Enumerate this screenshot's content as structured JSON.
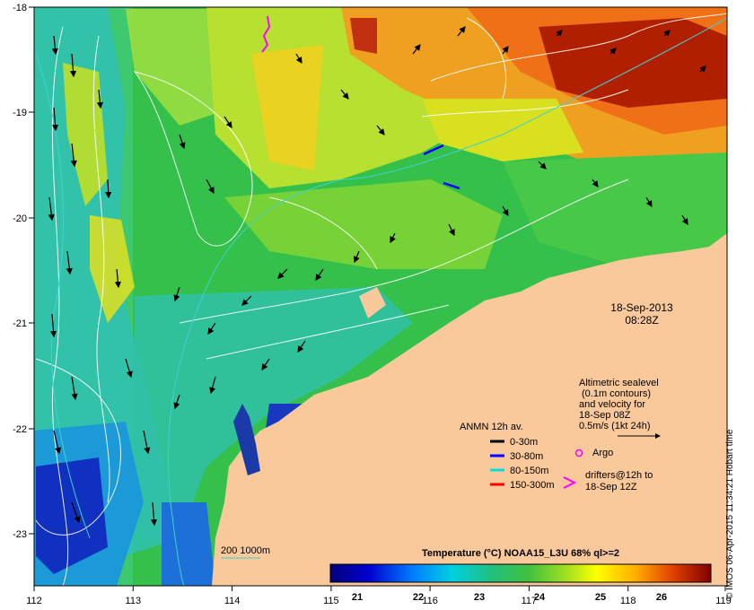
{
  "map": {
    "lon_ticks": [
      "112",
      "113",
      "114",
      "115",
      "116",
      "117",
      "118",
      "119"
    ],
    "lat_ticks": [
      "-18",
      "-19",
      "-20",
      "-21",
      "-22",
      "-23"
    ],
    "date": "18-Sep-2013",
    "time": "08:28Z",
    "altimetry_note": [
      "Altimetric sealevel",
      "(0.1m contours)",
      "and velocity for",
      "18-Sep 08Z",
      "0.5m/s (1kt 24h)"
    ],
    "anmn_title": "ANMN 12h av.",
    "anmn_depths": [
      {
        "label": "0-30m",
        "color": "#000000"
      },
      {
        "label": "30-80m",
        "color": "#0000ff"
      },
      {
        "label": "80-150m",
        "color": "#00e0e0"
      },
      {
        "label": "150-300m",
        "color": "#ff0000"
      }
    ],
    "argo_label": "Argo",
    "drifters_label": [
      "drifters@12h to",
      "18-Sep 12Z"
    ],
    "bathy_label": "200  1000m",
    "colorbar_title": "Temperature (°C) NOAA15_L3U 68% ql>=2",
    "colorbar_ticks": [
      "21",
      "22",
      "23",
      "24",
      "25",
      "26"
    ],
    "credit": "© IMOS 06-Apr-2015 11:34:21 Hobart time",
    "colors": {
      "land": "#f9c89b",
      "argo": "#ff00ff",
      "drifter": "#ff00ff",
      "contour": "#ffffff",
      "bathy": "#40d0d0"
    }
  }
}
